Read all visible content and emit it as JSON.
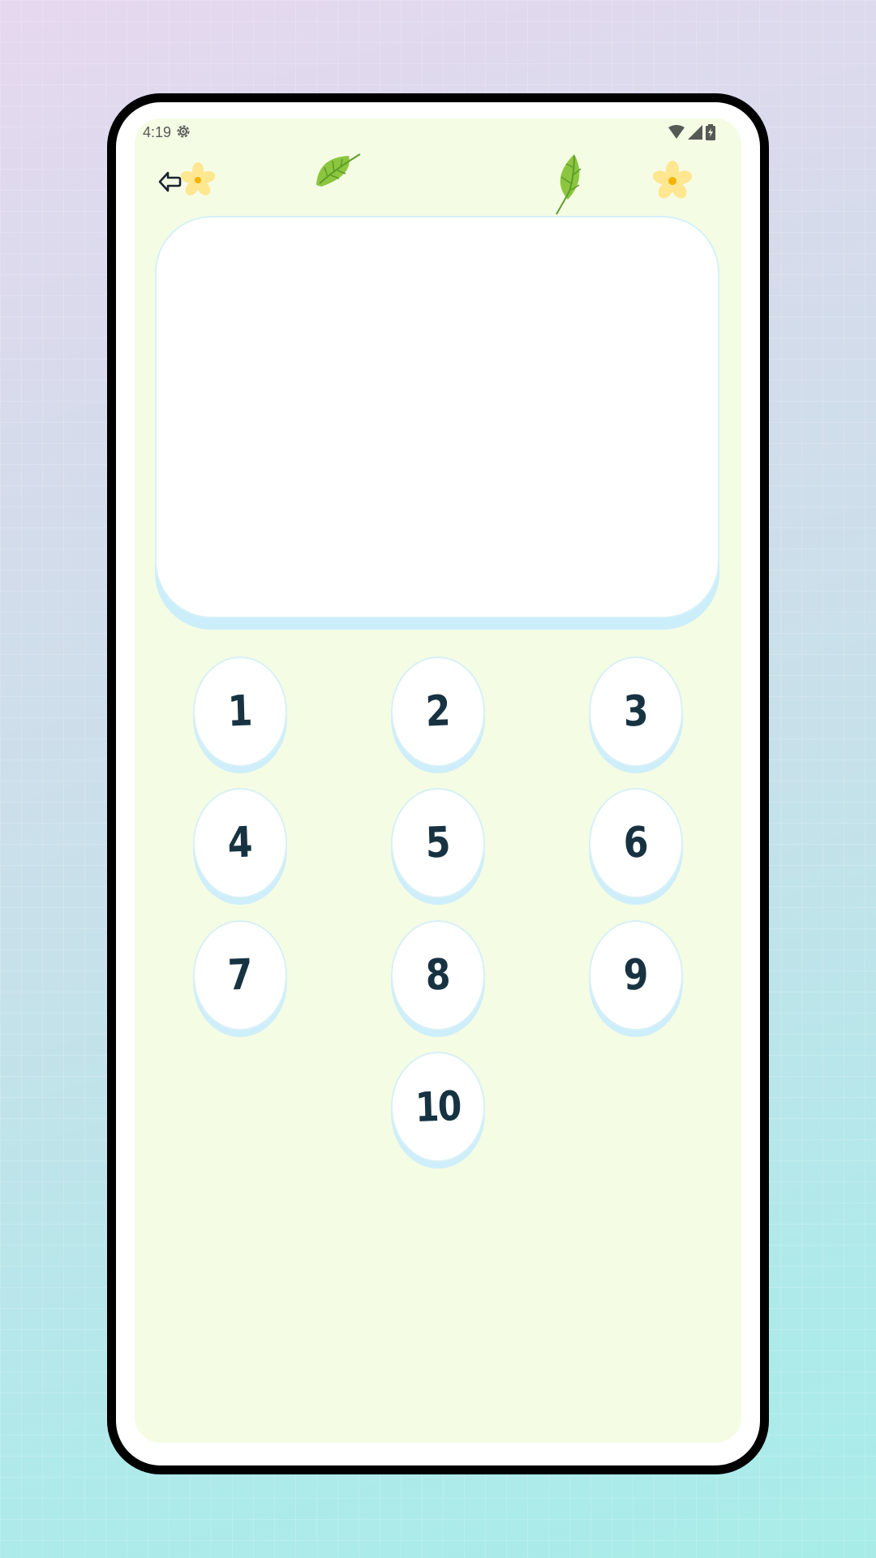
{
  "status_bar": {
    "time": "4:19",
    "icons": [
      "settings-icon",
      "wifi-icon",
      "cell-signal-icon",
      "battery-icon"
    ]
  },
  "header": {
    "back_icon": "back-arrow-icon",
    "decorations": [
      "flower-icon",
      "leaf-icon",
      "leaf-icon",
      "flower-icon"
    ]
  },
  "display": {
    "text": ""
  },
  "keypad": {
    "buttons": [
      "1",
      "2",
      "3",
      "4",
      "5",
      "6",
      "7",
      "8",
      "9",
      "10"
    ]
  },
  "colors": {
    "screen_background": "#f5fce4",
    "button_face": "#ffffff",
    "button_shadow": "#cdeefa",
    "digit_color": "#173342",
    "leaf_green": "#8cc63f",
    "flower_yellow": "#ffe690"
  }
}
